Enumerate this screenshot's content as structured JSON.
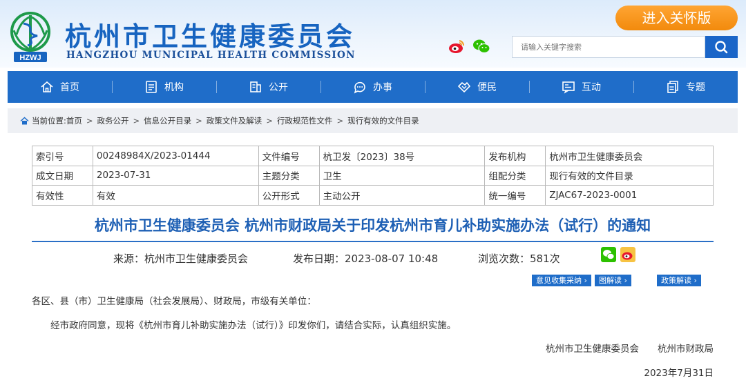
{
  "header": {
    "title": "杭州市卫生健康委员会",
    "subtitle": "HANGZHOU MUNICIPAL HEALTH COMMISSION",
    "logo_text": "HZWJ",
    "care_button": "进入关怀版",
    "search_placeholder": "请输入关键字搜索"
  },
  "nav": [
    {
      "label": "首页",
      "icon": "home-icon"
    },
    {
      "label": "机构",
      "icon": "org-icon"
    },
    {
      "label": "公开",
      "icon": "open-icon"
    },
    {
      "label": "办事",
      "icon": "service-icon"
    },
    {
      "label": "便民",
      "icon": "convenience-icon"
    },
    {
      "label": "互动",
      "icon": "interact-icon"
    },
    {
      "label": "专题",
      "icon": "topic-icon"
    }
  ],
  "breadcrumb": {
    "prefix": "当前位置:",
    "items": [
      "首页",
      "政务公开",
      "信息公开目录",
      "政策文件及解读",
      "行政规范性文件",
      "现行有效的文件目录"
    ],
    "sep": ">"
  },
  "info_table": [
    [
      {
        "k": "索引号",
        "v": "00248984X/2023-01444"
      },
      {
        "k": "文件编号",
        "v": "杭卫发〔2023〕38号"
      },
      {
        "k": "发布机构",
        "v": "杭州市卫生健康委员会"
      }
    ],
    [
      {
        "k": "成文日期",
        "v": "2023-07-31"
      },
      {
        "k": "主题分类",
        "v": "卫生"
      },
      {
        "k": "组配分类",
        "v": "现行有效的文件目录"
      }
    ],
    [
      {
        "k": "有效性",
        "v": "有效"
      },
      {
        "k": "公开形式",
        "v": "主动公开"
      },
      {
        "k": "统一编号",
        "v": "ZJAC67-2023-0001"
      }
    ]
  ],
  "article": {
    "title": "杭州市卫生健康委员会 杭州市财政局关于印发杭州市育儿补助实施办法（试行）的通知",
    "source": "来源：杭州市卫生健康委员会",
    "publish_date": "发布日期：2023-08-07 10:48",
    "views": "浏览次数：581次",
    "tags": [
      "意见收集采纳 ›",
      "图解读 ›",
      "政策解读 ›"
    ],
    "salutation": "各区、县（市）卫生健康局（社会发展局）、财政局，市级有关单位：",
    "body": "经市政府同意，现将《杭州市育儿补助实施办法（试行）》印发你们，请结合实际，认真组织实施。",
    "signature": "杭州市卫生健康委员会　　杭州市财政局",
    "date": "2023年7月31日"
  },
  "colors": {
    "brand_blue": "#1f6dc9",
    "accent_orange": "#f39a1e",
    "title_blue": "#1d5fb4"
  }
}
